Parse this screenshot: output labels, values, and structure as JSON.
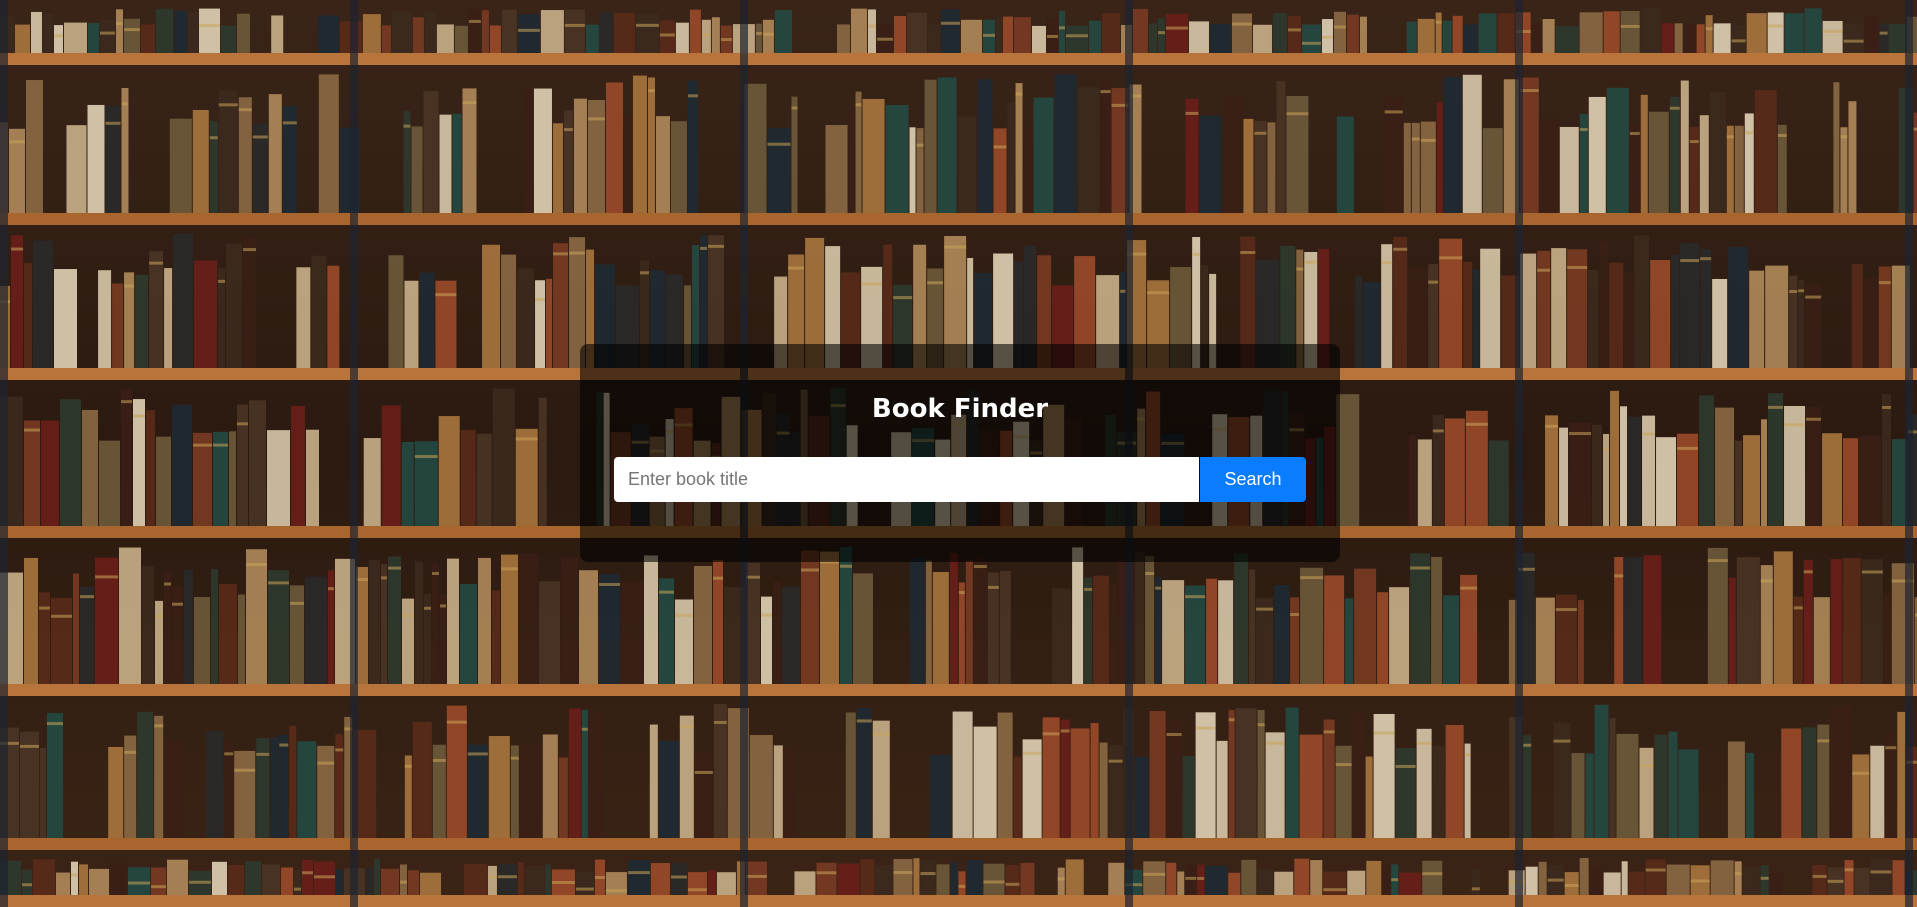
{
  "app": {
    "title": "Book Finder"
  },
  "search": {
    "placeholder": "Enter book title",
    "value": "",
    "button_label": "Search"
  },
  "colors": {
    "accent": "#0a7cff",
    "panel_overlay": "rgba(0,0,0,0.58)",
    "title_text": "#ffffff"
  },
  "background": {
    "image": "bookshelf-photo"
  }
}
